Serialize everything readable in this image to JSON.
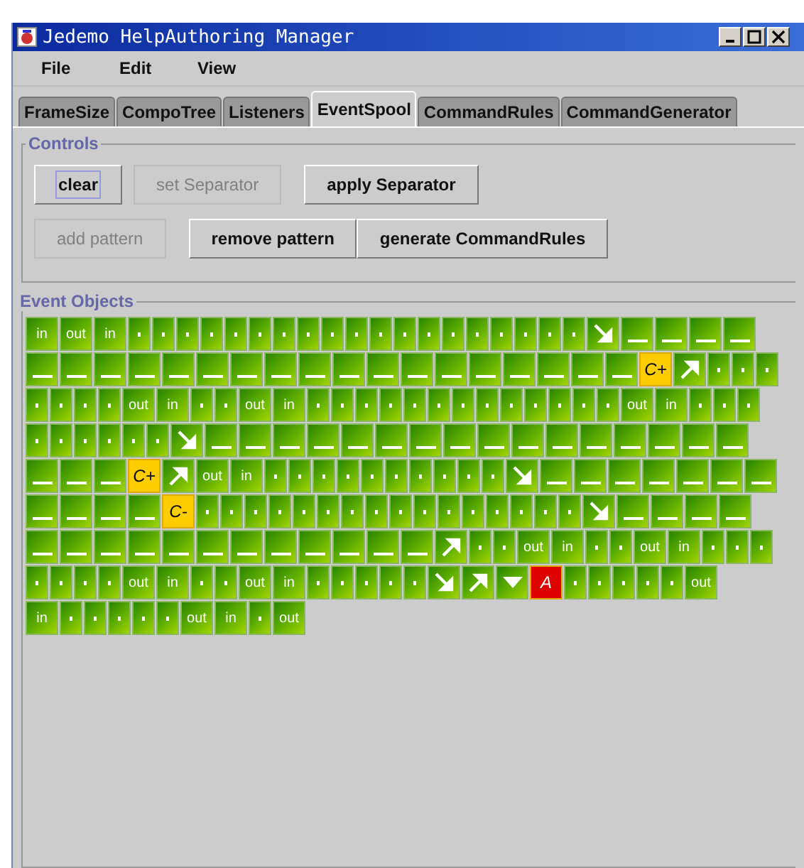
{
  "window": {
    "title": "Jedemo HelpAuthoring Manager"
  },
  "menu": [
    "File",
    "Edit",
    "View"
  ],
  "tabs": [
    {
      "label": "FrameSize",
      "selected": false
    },
    {
      "label": "CompoTree",
      "selected": false
    },
    {
      "label": "Listeners",
      "selected": false
    },
    {
      "label": "EventSpool",
      "selected": true
    },
    {
      "label": "CommandRules",
      "selected": false
    },
    {
      "label": "CommandGenerator",
      "selected": false
    }
  ],
  "controls": {
    "title": "Controls",
    "button_rows": [
      [
        {
          "label": "clear",
          "disabled": false,
          "focused": true
        },
        {
          "label": "set Separator",
          "disabled": true,
          "focused": false
        },
        {
          "label": "apply Separator",
          "disabled": false,
          "focused": false
        }
      ],
      [
        {
          "label": "add pattern",
          "disabled": true,
          "focused": false
        },
        {
          "label": "remove pattern",
          "disabled": false,
          "focused": false
        },
        {
          "label": "generate CommandRules",
          "disabled": false,
          "focused": false
        }
      ]
    ]
  },
  "event_objects": {
    "title": "Event Objects",
    "lines": [
      {
        "events": [
          {
            "kind": "text",
            "label": "in"
          },
          {
            "kind": "text",
            "label": "out"
          },
          {
            "kind": "text",
            "label": "in"
          },
          {
            "kind": "dot"
          },
          {
            "kind": "dot"
          },
          {
            "kind": "dot"
          },
          {
            "kind": "dot"
          },
          {
            "kind": "dot"
          },
          {
            "kind": "dot"
          },
          {
            "kind": "dot"
          },
          {
            "kind": "dot"
          },
          {
            "kind": "dot"
          },
          {
            "kind": "dot"
          },
          {
            "kind": "dot"
          },
          {
            "kind": "dot"
          },
          {
            "kind": "dot"
          },
          {
            "kind": "dot"
          },
          {
            "kind": "dot"
          },
          {
            "kind": "dot"
          },
          {
            "kind": "dot"
          },
          {
            "kind": "dot"
          },
          {
            "kind": "dot"
          },
          {
            "kind": "down"
          },
          {
            "kind": "dash"
          },
          {
            "kind": "dash"
          },
          {
            "kind": "dash"
          },
          {
            "kind": "dash"
          }
        ]
      },
      {
        "events": [
          {
            "kind": "dash"
          },
          {
            "kind": "dash"
          },
          {
            "kind": "dash"
          },
          {
            "kind": "dash"
          },
          {
            "kind": "dash"
          },
          {
            "kind": "dash"
          },
          {
            "kind": "dash"
          },
          {
            "kind": "dash"
          },
          {
            "kind": "dash"
          },
          {
            "kind": "dash"
          },
          {
            "kind": "dash"
          },
          {
            "kind": "dash"
          },
          {
            "kind": "dash"
          },
          {
            "kind": "dash"
          },
          {
            "kind": "dash"
          },
          {
            "kind": "dash"
          },
          {
            "kind": "dash"
          },
          {
            "kind": "dash"
          },
          {
            "kind": "key",
            "label": "C+",
            "color": "#ffcc00"
          },
          {
            "kind": "up"
          },
          {
            "kind": "dot"
          },
          {
            "kind": "dot"
          },
          {
            "kind": "dot"
          }
        ]
      },
      {
        "events": [
          {
            "kind": "dot"
          },
          {
            "kind": "dot"
          },
          {
            "kind": "dot"
          },
          {
            "kind": "dot"
          },
          {
            "kind": "text",
            "label": "out"
          },
          {
            "kind": "text",
            "label": "in"
          },
          {
            "kind": "dot"
          },
          {
            "kind": "dot"
          },
          {
            "kind": "text",
            "label": "out"
          },
          {
            "kind": "text",
            "label": "in"
          },
          {
            "kind": "dot"
          },
          {
            "kind": "dot"
          },
          {
            "kind": "dot"
          },
          {
            "kind": "dot"
          },
          {
            "kind": "dot"
          },
          {
            "kind": "dot"
          },
          {
            "kind": "dot"
          },
          {
            "kind": "dot"
          },
          {
            "kind": "dot"
          },
          {
            "kind": "dot"
          },
          {
            "kind": "dot"
          },
          {
            "kind": "dot"
          },
          {
            "kind": "dot"
          },
          {
            "kind": "text",
            "label": "out"
          },
          {
            "kind": "text",
            "label": "in"
          },
          {
            "kind": "dot"
          },
          {
            "kind": "dot"
          },
          {
            "kind": "dot"
          }
        ]
      },
      {
        "events": [
          {
            "kind": "dot"
          },
          {
            "kind": "dot"
          },
          {
            "kind": "dot"
          },
          {
            "kind": "dot"
          },
          {
            "kind": "dot"
          },
          {
            "kind": "dot"
          },
          {
            "kind": "down"
          },
          {
            "kind": "dash"
          },
          {
            "kind": "dash"
          },
          {
            "kind": "dash"
          },
          {
            "kind": "dash"
          },
          {
            "kind": "dash"
          },
          {
            "kind": "dash"
          },
          {
            "kind": "dash"
          },
          {
            "kind": "dash"
          },
          {
            "kind": "dash"
          },
          {
            "kind": "dash"
          },
          {
            "kind": "dash"
          },
          {
            "kind": "dash"
          },
          {
            "kind": "dash"
          },
          {
            "kind": "dash"
          },
          {
            "kind": "dash"
          },
          {
            "kind": "dash"
          }
        ]
      },
      {
        "events": [
          {
            "kind": "dash"
          },
          {
            "kind": "dash"
          },
          {
            "kind": "dash"
          },
          {
            "kind": "key",
            "label": "C+",
            "color": "#ffcc00"
          },
          {
            "kind": "up"
          },
          {
            "kind": "text",
            "label": "out"
          },
          {
            "kind": "text",
            "label": "in"
          },
          {
            "kind": "dot"
          },
          {
            "kind": "dot"
          },
          {
            "kind": "dot"
          },
          {
            "kind": "dot"
          },
          {
            "kind": "dot"
          },
          {
            "kind": "dot"
          },
          {
            "kind": "dot"
          },
          {
            "kind": "dot"
          },
          {
            "kind": "dot"
          },
          {
            "kind": "dot"
          },
          {
            "kind": "down"
          },
          {
            "kind": "dash"
          },
          {
            "kind": "dash"
          },
          {
            "kind": "dash"
          },
          {
            "kind": "dash"
          },
          {
            "kind": "dash"
          },
          {
            "kind": "dash"
          },
          {
            "kind": "dash"
          }
        ]
      },
      {
        "events": [
          {
            "kind": "dash"
          },
          {
            "kind": "dash"
          },
          {
            "kind": "dash"
          },
          {
            "kind": "dash"
          },
          {
            "kind": "key",
            "label": "C-",
            "color": "#ffcc00"
          },
          {
            "kind": "dot"
          },
          {
            "kind": "dot"
          },
          {
            "kind": "dot"
          },
          {
            "kind": "dot"
          },
          {
            "kind": "dot"
          },
          {
            "kind": "dot"
          },
          {
            "kind": "dot"
          },
          {
            "kind": "dot"
          },
          {
            "kind": "dot"
          },
          {
            "kind": "dot"
          },
          {
            "kind": "dot"
          },
          {
            "kind": "dot"
          },
          {
            "kind": "dot"
          },
          {
            "kind": "dot"
          },
          {
            "kind": "dot"
          },
          {
            "kind": "dot"
          },
          {
            "kind": "down"
          },
          {
            "kind": "dash"
          },
          {
            "kind": "dash"
          },
          {
            "kind": "dash"
          },
          {
            "kind": "dash"
          }
        ]
      },
      {
        "events": [
          {
            "kind": "dash"
          },
          {
            "kind": "dash"
          },
          {
            "kind": "dash"
          },
          {
            "kind": "dash"
          },
          {
            "kind": "dash"
          },
          {
            "kind": "dash"
          },
          {
            "kind": "dash"
          },
          {
            "kind": "dash"
          },
          {
            "kind": "dash"
          },
          {
            "kind": "dash"
          },
          {
            "kind": "dash"
          },
          {
            "kind": "dash"
          },
          {
            "kind": "up"
          },
          {
            "kind": "dot"
          },
          {
            "kind": "dot"
          },
          {
            "kind": "text",
            "label": "out"
          },
          {
            "kind": "text",
            "label": "in"
          },
          {
            "kind": "dot"
          },
          {
            "kind": "dot"
          },
          {
            "kind": "text",
            "label": "out"
          },
          {
            "kind": "text",
            "label": "in"
          },
          {
            "kind": "dot"
          },
          {
            "kind": "dot"
          },
          {
            "kind": "dot"
          }
        ]
      },
      {
        "events": [
          {
            "kind": "dot"
          },
          {
            "kind": "dot"
          },
          {
            "kind": "dot"
          },
          {
            "kind": "dot"
          },
          {
            "kind": "text",
            "label": "out"
          },
          {
            "kind": "text",
            "label": "in"
          },
          {
            "kind": "dot"
          },
          {
            "kind": "dot"
          },
          {
            "kind": "text",
            "label": "out"
          },
          {
            "kind": "text",
            "label": "in"
          },
          {
            "kind": "dot"
          },
          {
            "kind": "dot"
          },
          {
            "kind": "dot"
          },
          {
            "kind": "dot"
          },
          {
            "kind": "dot"
          },
          {
            "kind": "down"
          },
          {
            "kind": "up"
          },
          {
            "kind": "press"
          },
          {
            "kind": "key",
            "label": "A",
            "color": "#dd0000"
          },
          {
            "kind": "dot"
          },
          {
            "kind": "dot"
          },
          {
            "kind": "dot"
          },
          {
            "kind": "dot"
          },
          {
            "kind": "dot"
          },
          {
            "kind": "text",
            "label": "out"
          }
        ]
      },
      {
        "events": [
          {
            "kind": "text",
            "label": "in"
          },
          {
            "kind": "dot"
          },
          {
            "kind": "dot"
          },
          {
            "kind": "dot"
          },
          {
            "kind": "dot"
          },
          {
            "kind": "dot"
          },
          {
            "kind": "text",
            "label": "out"
          },
          {
            "kind": "text",
            "label": "in"
          },
          {
            "kind": "dot"
          },
          {
            "kind": "text",
            "label": "out"
          }
        ]
      }
    ]
  }
}
